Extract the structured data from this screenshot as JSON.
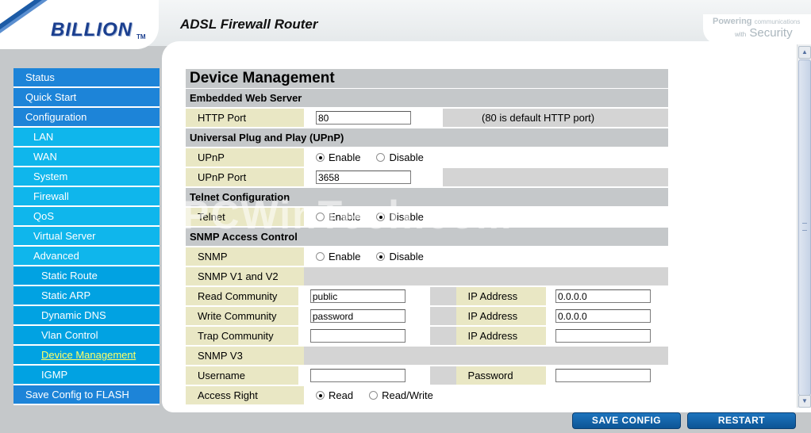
{
  "header": {
    "logo": "BILLION",
    "logo_tm": "TM",
    "product_title": "ADSL Firewall Router",
    "slogan_line1_a": "Powering",
    "slogan_line1_b": "communications",
    "slogan_line2_a": "with",
    "slogan_line2_b": "Security"
  },
  "nav": {
    "items": [
      {
        "label": "Status",
        "level": 1
      },
      {
        "label": "Quick Start",
        "level": 1
      },
      {
        "label": "Configuration",
        "level": 1
      },
      {
        "label": "LAN",
        "level": 2
      },
      {
        "label": "WAN",
        "level": 2
      },
      {
        "label": "System",
        "level": 2
      },
      {
        "label": "Firewall",
        "level": 2
      },
      {
        "label": "QoS",
        "level": 2
      },
      {
        "label": "Virtual Server",
        "level": 2
      },
      {
        "label": "Advanced",
        "level": 2
      },
      {
        "label": "Static Route",
        "level": 3
      },
      {
        "label": "Static ARP",
        "level": 3
      },
      {
        "label": "Dynamic DNS",
        "level": 3
      },
      {
        "label": "Vlan Control",
        "level": 3
      },
      {
        "label": "Device Management",
        "level": 3,
        "active": true
      },
      {
        "label": "IGMP",
        "level": 3
      },
      {
        "label": "Save Config to FLASH",
        "level": 1
      }
    ]
  },
  "form": {
    "title": "Device Management",
    "web_server": {
      "heading": "Embedded Web Server",
      "http_port_label": "HTTP Port",
      "http_port_value": "80",
      "http_port_note": "(80 is default HTTP port)"
    },
    "upnp": {
      "heading": "Universal Plug and Play (UPnP)",
      "upnp_label": "UPnP",
      "enable_label": "Enable",
      "disable_label": "Disable",
      "selected": "enable",
      "port_label": "UPnP Port",
      "port_value": "3658"
    },
    "telnet": {
      "heading": "Telnet Configuration",
      "telnet_label": "Telnet",
      "enable_label": "Enable",
      "disable_label": "Disable",
      "selected": "disable"
    },
    "snmp": {
      "heading": "SNMP Access Control",
      "snmp_label": "SNMP",
      "enable_label": "Enable",
      "disable_label": "Disable",
      "selected": "disable",
      "v1v2_label": "SNMP V1 and V2",
      "read_community_label": "Read Community",
      "read_community_value": "public",
      "write_community_label": "Write Community",
      "write_community_value": "password",
      "trap_community_label": "Trap Community",
      "trap_community_value": "",
      "ip_address_label": "IP Address",
      "read_ip_value": "0.0.0.0",
      "write_ip_value": "0.0.0.0",
      "trap_ip_value": "",
      "v3_label": "SNMP V3",
      "username_label": "Username",
      "username_value": "",
      "password_label": "Password",
      "password_value": "",
      "access_right_label": "Access Right",
      "read_label": "Read",
      "readwrite_label": "Read/Write",
      "access_selected": "read"
    }
  },
  "watermark": "PCWinTech.com",
  "buttons": {
    "save_config": "SAVE CONFIG",
    "restart": "RESTART"
  },
  "scrollbar": {
    "up_glyph": "▲",
    "down_glyph": "▼"
  }
}
